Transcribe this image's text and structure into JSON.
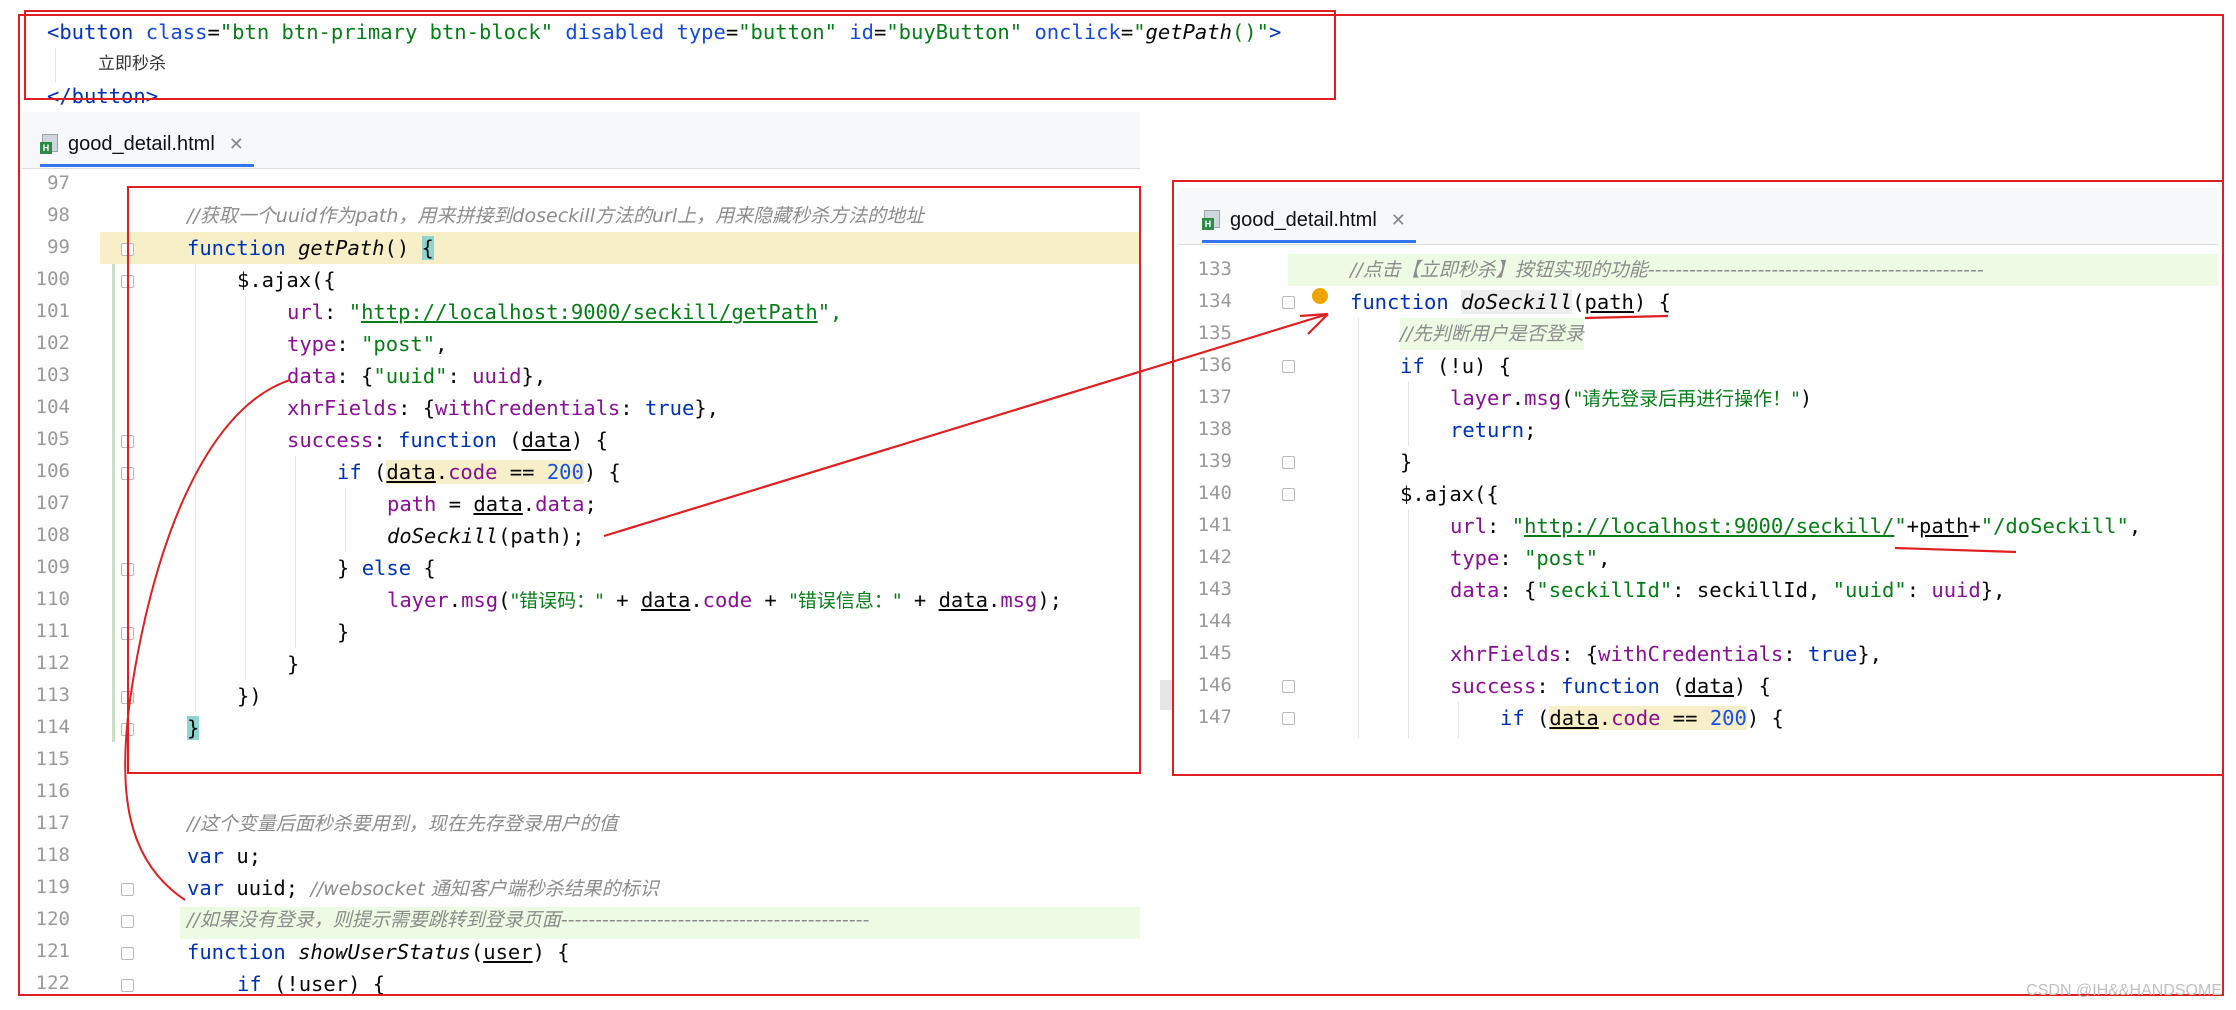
{
  "top_snippet": {
    "line1": {
      "open": "<button ",
      "a1": "class",
      "v1": "\"btn btn-primary btn-block\"",
      "a2": "disabled",
      "a3": "type",
      "v3": "\"button\"",
      "a4": "id",
      "v4": "\"buyButton\"",
      "a5": "onclick",
      "v5a": "\"",
      "v5fn": "getPath",
      "v5b": "()\"",
      "close": ">"
    },
    "line2": "立即秒杀",
    "line3": "</button>"
  },
  "left_editor": {
    "tab_label": "good_detail.html",
    "line_numbers": [
      "97",
      "98",
      "99",
      "100",
      "101",
      "102",
      "103",
      "104",
      "105",
      "106",
      "107",
      "108",
      "109",
      "110",
      "111",
      "112",
      "113",
      "114",
      "115",
      "116",
      "117",
      "118",
      "119",
      "120",
      "121",
      "122"
    ],
    "l98_cmt": "//获取一个uuid作为path，用来拼接到doseckill方法的url上，用来隐藏秒杀方法的地址",
    "l99_kw": "function",
    "l99_fn": "getPath",
    "l99_rest": "() ",
    "l99_brace": "{",
    "l100": "$.ajax({",
    "l101_key": "url",
    "l101_colon": ": ",
    "l101_q1": "\"",
    "l101_url": "http://localhost:9000/seckill/getPath",
    "l101_q2": "\",",
    "l102_key": "type",
    "l102_colon": ": ",
    "l102_val": "\"post\"",
    "l102_end": ",",
    "l103_key": "data",
    "l103_mid": ": {",
    "l103_k": "\"uuid\"",
    "l103_mid2": ": ",
    "l103_v": "uuid",
    "l103_end": "},",
    "l104_key": "xhrFields",
    "l104_mid": ": {",
    "l104_k": "withCredentials",
    "l104_mid2": ": ",
    "l104_v": "true",
    "l104_end": "},",
    "l105_key": "success",
    "l105_mid": ": ",
    "l105_kw": "function",
    "l105_p1": " (",
    "l105_arg": "data",
    "l105_p2": ") {",
    "l106_kw": "if",
    "l106_p1": " (",
    "l106_obj": "data",
    "l106_dot": ".",
    "l106_prop": "code",
    "l106_op": " == ",
    "l106_num": "200",
    "l106_end": ") {",
    "l107_a": "path",
    "l107_b": " = ",
    "l107_obj": "data",
    "l107_dot": ".",
    "l107_prop": "data",
    "l107_end": ";",
    "l108_fn": "doSeckill",
    "l108_rest": "(path);",
    "l109_a": "} ",
    "l109_kw": "else",
    "l109_b": " {",
    "l110_obj": "layer",
    "l110_dot": ".",
    "l110_m": "msg",
    "l110_p": "(",
    "l110_s1": "\"错误码：\"",
    "l110_plus1": " + ",
    "l110_d1": "data",
    "l110_dot2": ".",
    "l110_code": "code",
    "l110_plus2": " + ",
    "l110_s2": "\"错误信息：\"",
    "l110_plus3": " + ",
    "l110_d2": "data",
    "l110_dot3": ".",
    "l110_msg": "msg",
    "l110_end": ");",
    "l111": "}",
    "l112": "}",
    "l113": "})",
    "l114": "}",
    "l117_cmt": "//这个变量后面秒杀要用到，现在先存登录用户的值",
    "l118_kw": "var",
    "l118_rest": " u;",
    "l119_kw": "var",
    "l119_rest": " uuid; ",
    "l119_cmt": "//websocket 通知客户端秒杀结果的标识",
    "l120_cmt": "//如果没有登录，则提示需要跳转到登录页面---------------------------------------------",
    "l121_kw": "function",
    "l121_fn": "showUserStatus",
    "l121_p1": "(",
    "l121_arg": "user",
    "l121_p2": ") {",
    "l122_kw": "if",
    "l122_rest": " (!user) {"
  },
  "right_editor": {
    "tab_label": "good_detail.html",
    "line_numbers": [
      "133",
      "134",
      "135",
      "136",
      "137",
      "138",
      "139",
      "140",
      "141",
      "142",
      "143",
      "144",
      "145",
      "146",
      "147"
    ],
    "l133_cmt": "//点击【立即秒杀】按钮实现的功能-------------------------------------------------",
    "l134_kw": "function",
    "l134_fn": "doSeckill",
    "l134_p1": "(",
    "l134_arg": "path",
    "l134_p2": ") {",
    "l135_cmt": "//先判断用户是否登录",
    "l136_kw": "if",
    "l136_rest": " (!u) {",
    "l137_obj": "layer",
    "l137_dot": ".",
    "l137_m": "msg",
    "l137_p": "(",
    "l137_s": "\"请先登录后再进行操作！\"",
    "l137_end": ")",
    "l138_kw": "return",
    "l138_end": ";",
    "l139": "}",
    "l140": "$.ajax({",
    "l141_key": "url",
    "l141_colon": ": ",
    "l141_q1": "\"",
    "l141_url": "http://localhost:9000/seckill/",
    "l141_q2": "\"",
    "l141_plus1": "+",
    "l141_path": "path",
    "l141_plus2": "+",
    "l141_s": "\"/doSeckill\"",
    "l141_end": ",",
    "l142_key": "type",
    "l142_colon": ": ",
    "l142_val": "\"post\"",
    "l142_end": ",",
    "l143_key": "data",
    "l143_mid": ": {",
    "l143_k1": "\"seckillId\"",
    "l143_c1": ": seckillId, ",
    "l143_k2": "\"uuid\"",
    "l143_c2": ": ",
    "l143_v2": "uuid",
    "l143_end": "},",
    "l145_key": "xhrFields",
    "l145_mid": ": {",
    "l145_k": "withCredentials",
    "l145_mid2": ": ",
    "l145_v": "true",
    "l145_end": "},",
    "l146_key": "success",
    "l146_mid": ": ",
    "l146_kw": "function",
    "l146_p1": " (",
    "l146_arg": "data",
    "l146_p2": ") {",
    "l147_kw": "if",
    "l147_p1": " (",
    "l147_obj": "data",
    "l147_dot": ".",
    "l147_prop": "code",
    "l147_op": " == ",
    "l147_num": "200",
    "l147_end": ") {"
  },
  "watermark": "CSDN @IH&&HANDSOME",
  "colors": {
    "annotation_red": "#e02020",
    "keyword": "#0033b3",
    "string": "#067d17",
    "property": "#871094",
    "number": "#1750eb",
    "comment": "#8c8c8c"
  }
}
